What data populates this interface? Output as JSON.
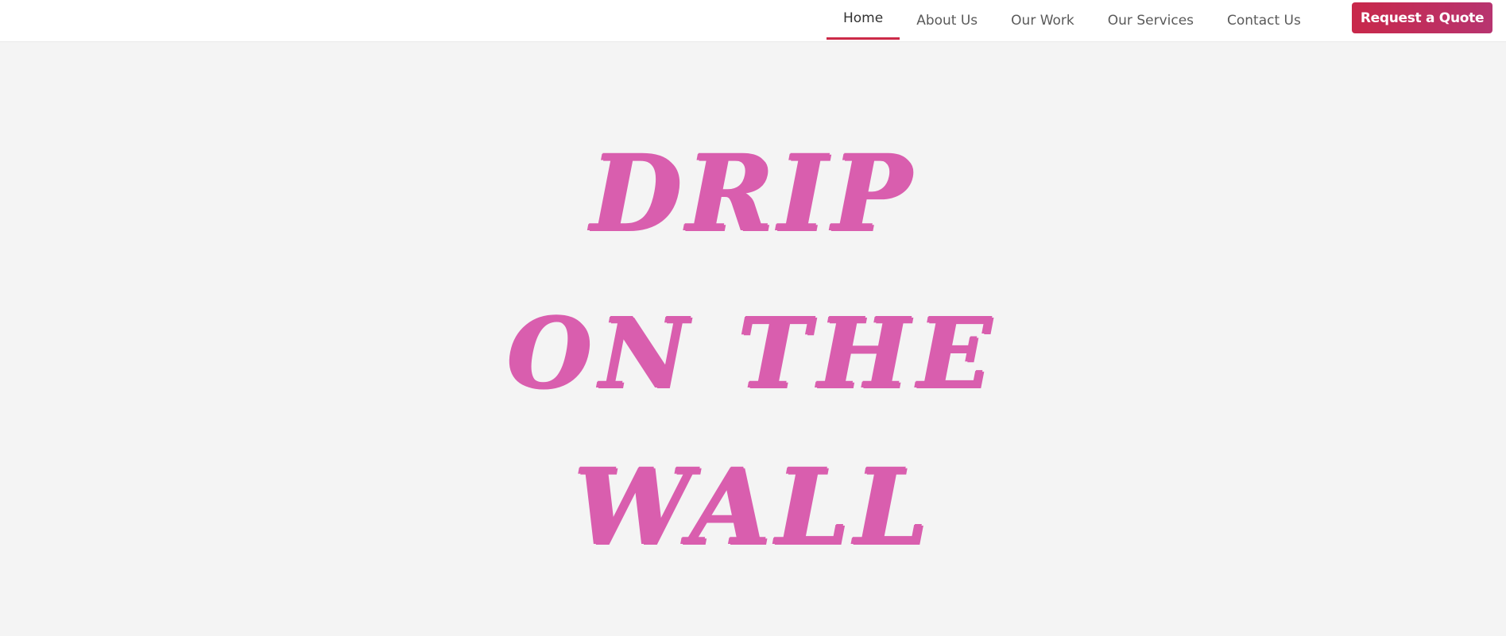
{
  "nav": {
    "items": [
      {
        "label": "Home",
        "active": true
      },
      {
        "label": "About Us",
        "active": false
      },
      {
        "label": "Our Work",
        "active": false
      },
      {
        "label": "Our Services",
        "active": false
      },
      {
        "label": "Contact Us",
        "active": false
      }
    ],
    "cta_label": "Request a Quote"
  },
  "hero": {
    "title_lines": [
      "DRIP",
      "ON THE",
      "WALL"
    ]
  },
  "colors": {
    "accent": "#cc2a48",
    "title_pink": "#d95eae",
    "background": "#f4f4f4"
  }
}
